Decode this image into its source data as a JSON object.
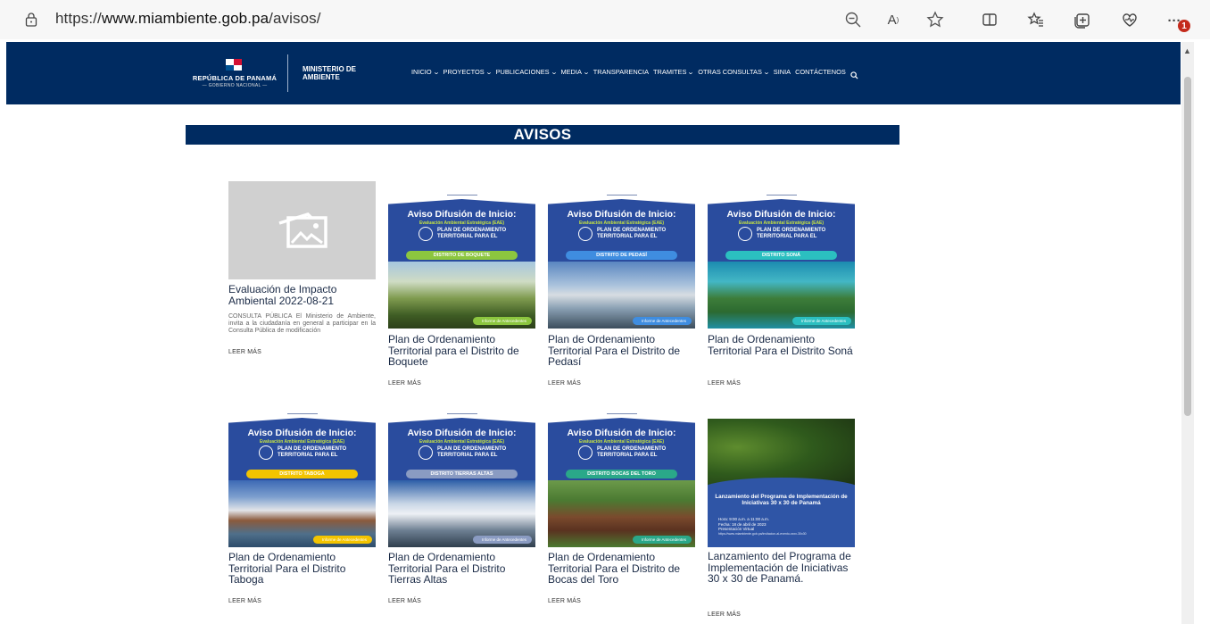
{
  "browser": {
    "url_prefix": "https://",
    "url_host": "www.miambiente.gob.pa",
    "url_path": "/avisos/",
    "read_aloud_label": "A",
    "more_label": "···",
    "notification_count": "1"
  },
  "header": {
    "republic": "REPÚBLICA DE PANAMÁ",
    "republic_sub": "— GOBIERNO NACIONAL —",
    "ministry": "MINISTERIO DE AMBIENTE",
    "nav": [
      {
        "label": "INICIO",
        "dropdown": true
      },
      {
        "label": "PROYECTOS",
        "dropdown": true
      },
      {
        "label": "PUBLICACIONES",
        "dropdown": true
      },
      {
        "label": "MEDIA",
        "dropdown": true
      },
      {
        "label": "TRANSPARENCIA",
        "dropdown": false
      },
      {
        "label": "TRAMITES",
        "dropdown": true
      },
      {
        "label": "OTRAS CONSULTAS",
        "dropdown": true
      },
      {
        "label": "SINIA",
        "dropdown": false
      },
      {
        "label": "CONTÁCTENOS",
        "dropdown": false
      }
    ]
  },
  "page": {
    "title": "AVISOS",
    "read_more": "LEER MÁS"
  },
  "cards": [
    {
      "kind": "placeholder",
      "title": "Evaluación de Impacto Ambiental 2022-08-21",
      "desc": "CONSULTA PÚBLICA El Ministerio de Ambiente, invita a la ciudadanía en general a participar en la Consulta Pública de modificación"
    },
    {
      "kind": "poster",
      "poster_title": "Aviso Difusión de Inicio:",
      "poster_sub": "Evaluación Ambiental Estratégica (EAE)",
      "poster_plan": "PLAN DE ORDENAMIENTO TERRITORIAL PARA EL",
      "district": "DISTRITO DE BOQUETE",
      "pill_color": "#8cc63f",
      "tag": "Informe de Antecedentes",
      "tag_color": "#8cc63f",
      "photo": "rainbow-valley",
      "title": "Plan de Ordenamiento Territorial para el Distrito de Boquete"
    },
    {
      "kind": "poster",
      "poster_title": "Aviso Difusión de Inicio:",
      "poster_sub": "Evaluación Ambiental Estratégica (EAE)",
      "poster_plan": "PLAN DE ORDENAMIENTO TERRITORIAL PARA EL",
      "district": "DISTRITO DE PEDASÍ",
      "pill_color": "#3f8de0",
      "tag": "Informe de Antecedentes",
      "tag_color": "#3f8de0",
      "photo": "beach",
      "title": "Plan de Ordenamiento Territorial Para el Distrito de Pedasí"
    },
    {
      "kind": "poster",
      "poster_title": "Aviso Difusión de Inicio:",
      "poster_sub": "Evaluación Ambiental Estratégica (EAE)",
      "poster_plan": "PLAN DE ORDENAMIENTO TERRITORIAL PARA EL",
      "district": "DISTRITO SONÁ",
      "pill_color": "#2bbfc0",
      "tag": "Informe de Antecedentes",
      "tag_color": "#2bbfc0",
      "photo": "island",
      "title": "Plan de Ordenamiento Territorial Para el Distrito Soná"
    },
    {
      "kind": "poster",
      "poster_title": "Aviso Difusión de Inicio:",
      "poster_sub": "Evaluación Ambiental Estratégica (EAE)",
      "poster_plan": "PLAN DE ORDENAMIENTO TERRITORIAL PARA EL",
      "district": "DISTRITO TABOGA",
      "pill_color": "#f3c400",
      "tag": "Informe de Antecedentes",
      "tag_color": "#f3c400",
      "photo": "harbor",
      "title": "Plan de Ordenamiento Territorial Para el Distrito Taboga"
    },
    {
      "kind": "poster",
      "poster_title": "Aviso Difusión de Inicio:",
      "poster_sub": "Evaluación Ambiental Estratégica (EAE)",
      "poster_plan": "PLAN DE ORDENAMIENTO TERRITORIAL PARA EL",
      "district": "DISTRITO TIERRAS ALTAS",
      "pill_color": "#8a9bc2",
      "tag": "Informe de Antecedentes",
      "tag_color": "#8a9bc2",
      "photo": "clouds",
      "title": "Plan de Ordenamiento Territorial Para el Distrito Tierras Altas"
    },
    {
      "kind": "poster",
      "poster_title": "Aviso Difusión de Inicio:",
      "poster_sub": "Evaluación Ambiental Estratégica (EAE)",
      "poster_plan": "PLAN DE ORDENAMIENTO TERRITORIAL PARA EL",
      "district": "DISTRITO BOCAS DEL TORO",
      "pill_color": "#2aa889",
      "tag": "Informe de Antecedentes",
      "tag_color": "#2aa889",
      "photo": "house",
      "title": "Plan de Ordenamiento Territorial Para el Distrito de Bocas del Toro"
    },
    {
      "kind": "launch",
      "poster_title": "Lanzamiento del Programa de Implementación de Iniciativas 30 x 30 de Panamá",
      "poster_details": [
        "Hora: 9:00 a.m. a 11:00 a.m.",
        "Fecha: 18 de abril de 2023",
        "Presentación Virtual",
        "https://www.miambiente.gob.pa/invitacion-al-evento-xxxx-30x30"
      ],
      "title": "Lanzamiento del Programa de Implementación de Iniciativas 30 x 30 de Panamá."
    }
  ]
}
